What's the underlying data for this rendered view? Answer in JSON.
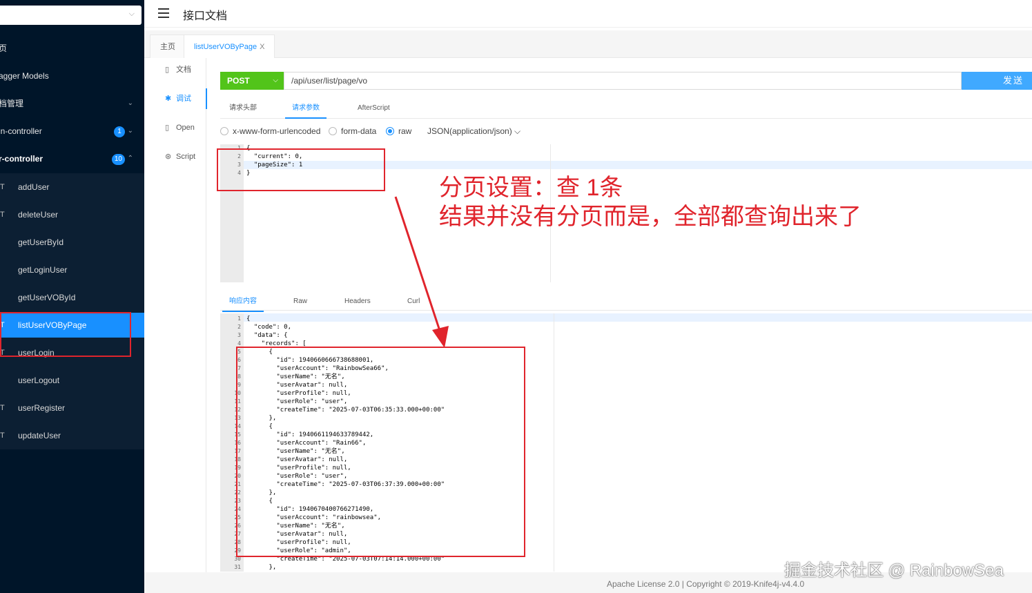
{
  "sidebar": {
    "search_text": "",
    "items": [
      {
        "label": "页"
      },
      {
        "label": "agger Models"
      },
      {
        "label": "档管理"
      },
      {
        "label": "in-controller",
        "badge": "1"
      },
      {
        "label": "r-controller",
        "badge": "10"
      }
    ],
    "submenu": [
      {
        "method": "T",
        "label": "addUser"
      },
      {
        "method": "T",
        "label": "deleteUser"
      },
      {
        "method": "",
        "label": "getUserById"
      },
      {
        "method": "",
        "label": "getLoginUser"
      },
      {
        "method": "",
        "label": "getUserVOById"
      },
      {
        "method": "T",
        "label": "listUserVOByPage"
      },
      {
        "method": "T",
        "label": "userLogin"
      },
      {
        "method": "",
        "label": "userLogout"
      },
      {
        "method": "T",
        "label": "userRegister"
      },
      {
        "method": "T",
        "label": "updateUser"
      }
    ]
  },
  "header": {
    "title": "接口文档"
  },
  "tabs": [
    {
      "label": "主页"
    },
    {
      "label": "listUserVOByPage",
      "close": "X"
    }
  ],
  "vtabs": [
    {
      "icon": "▯",
      "label": "文档"
    },
    {
      "icon": "✱",
      "label": "调试"
    },
    {
      "icon": "▯",
      "label": "Open"
    },
    {
      "icon": "⊛",
      "label": "Script"
    }
  ],
  "request": {
    "method": "POST",
    "url": "/api/user/list/page/vo",
    "send_label": "发送"
  },
  "request_tabs": [
    "请求头部",
    "请求参数",
    "AfterScript"
  ],
  "body_types": [
    "x-www-form-urlencoded",
    "form-data",
    "raw",
    "JSON(application/json)"
  ],
  "request_body": {
    "line_numbers": [
      "1",
      "2",
      "3",
      "4"
    ],
    "lines": [
      "{",
      "  \"current\": 0,",
      "  \"pageSize\": 1",
      "}"
    ]
  },
  "response_tabs": [
    "响应内容",
    "Raw",
    "Headers",
    "Curl"
  ],
  "response_body": {
    "line_numbers": [
      "1",
      "2",
      "3",
      "4",
      "5",
      "6",
      "7",
      "8",
      "9",
      "10",
      "11",
      "12",
      "13",
      "14",
      "15",
      "16",
      "17",
      "18",
      "19",
      "20",
      "21",
      "22",
      "23",
      "24",
      "25",
      "26",
      "27",
      "28",
      "29",
      "30",
      "31"
    ],
    "lines": [
      "{",
      "  \"code\": 0,",
      "  \"data\": {",
      "    \"records\": [",
      "      {",
      "        \"id\": 1940660666738688001,",
      "        \"userAccount\": \"RainbowSea66\",",
      "        \"userName\": \"无名\",",
      "        \"userAvatar\": null,",
      "        \"userProfile\": null,",
      "        \"userRole\": \"user\",",
      "        \"createTime\": \"2025-07-03T06:35:33.000+00:00\"",
      "      },",
      "      {",
      "        \"id\": 1940661194633789442,",
      "        \"userAccount\": \"Rain66\",",
      "        \"userName\": \"无名\",",
      "        \"userAvatar\": null,",
      "        \"userProfile\": null,",
      "        \"userRole\": \"user\",",
      "        \"createTime\": \"2025-07-03T06:37:39.000+00:00\"",
      "      },",
      "      {",
      "        \"id\": 1940670400766271490,",
      "        \"userAccount\": \"rainbowsea\",",
      "        \"userName\": \"无名\",",
      "        \"userAvatar\": null,",
      "        \"userProfile\": null,",
      "        \"userRole\": \"admin\",",
      "        \"createTime\": \"2025-07-03T07:14:14.000+00:00\"",
      "      },"
    ]
  },
  "annotation": {
    "line1": "分页设置：查 1条",
    "line2": "结果并没有分页而是，全部都查询出来了"
  },
  "footer": {
    "text": "Apache License 2.0 | Copyright © 2019-Knife4j-v4.4.0"
  },
  "watermark": "掘金技术社区 @ RainbowSea",
  "colors": {
    "sidebar_bg": "#001529",
    "accent": "#1890ff",
    "method_post": "#52c41a",
    "annotation": "#e0242c"
  }
}
